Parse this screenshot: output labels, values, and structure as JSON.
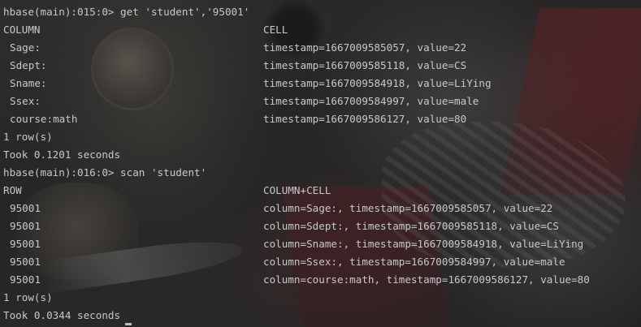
{
  "terminal": {
    "lines": [
      {
        "type": "prompt",
        "text": "hbase(main):015:0> get 'student','95001'"
      },
      {
        "type": "header",
        "left": "COLUMN",
        "right": "CELL"
      },
      {
        "type": "row",
        "left": "Sage:",
        "right": "timestamp=1667009585057, value=22"
      },
      {
        "type": "row",
        "left": "Sdept:",
        "right": "timestamp=1667009585118, value=CS"
      },
      {
        "type": "row",
        "left": "Sname:",
        "right": "timestamp=1667009584918, value=LiYing"
      },
      {
        "type": "row",
        "left": "Ssex:",
        "right": "timestamp=1667009584997, value=male"
      },
      {
        "type": "row",
        "left": "course:math",
        "right": "timestamp=1667009586127, value=80"
      },
      {
        "type": "text",
        "text": "1 row(s)"
      },
      {
        "type": "text",
        "text": "Took 0.1201 seconds"
      },
      {
        "type": "prompt",
        "text": "hbase(main):016:0> scan 'student'"
      },
      {
        "type": "header",
        "left": "ROW",
        "right": "COLUMN+CELL"
      },
      {
        "type": "row",
        "left": "95001",
        "right": "column=Sage:, timestamp=1667009585057, value=22"
      },
      {
        "type": "row",
        "left": "95001",
        "right": "column=Sdept:, timestamp=1667009585118, value=CS"
      },
      {
        "type": "row",
        "left": "95001",
        "right": "column=Sname:, timestamp=1667009584918, value=LiYing"
      },
      {
        "type": "row",
        "left": "95001",
        "right": "column=Ssex:, timestamp=1667009584997, value=male"
      },
      {
        "type": "row",
        "left": "95001",
        "right": "column=course:math, timestamp=1667009586127, value=80"
      },
      {
        "type": "text",
        "text": "1 row(s)"
      },
      {
        "type": "text",
        "text": "Took 0.0344 seconds"
      }
    ]
  },
  "theme": {
    "text_color": "#c6c8cc",
    "background": "#2b2b2b",
    "wallpaper_accent": "#8a2a30"
  }
}
